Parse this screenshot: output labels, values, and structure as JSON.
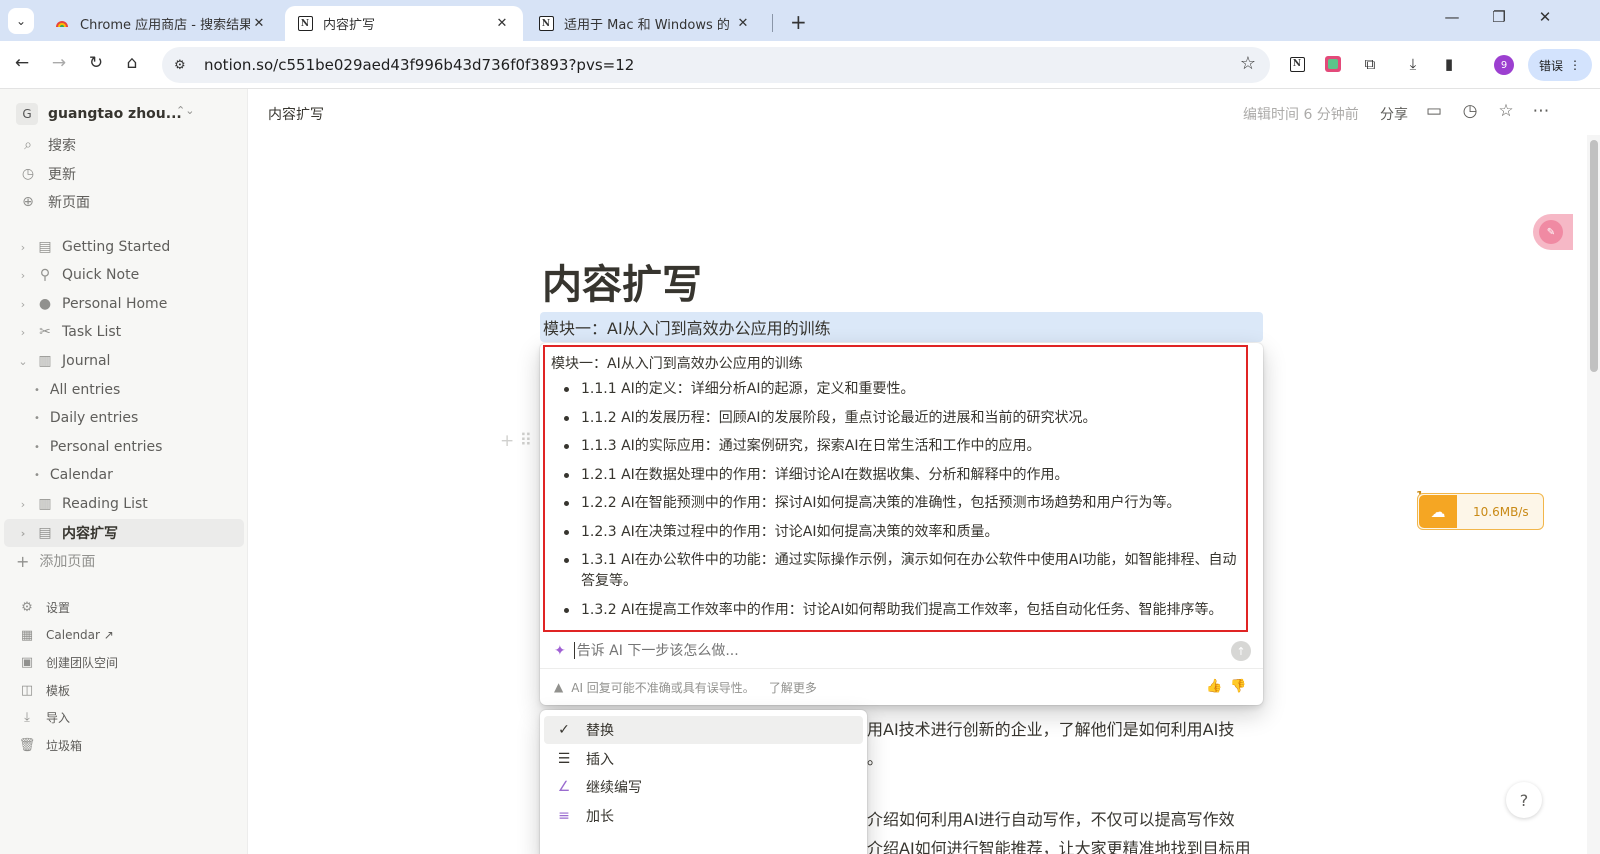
{
  "browser": {
    "tabs": [
      {
        "title": "Chrome 应用商店 - 搜索结果",
        "favicon": "chrome-webstore-icon"
      },
      {
        "title": "内容扩写",
        "favicon": "notion-icon"
      },
      {
        "title": "适用于 Mac 和 Windows 的 N",
        "favicon": "notion-icon"
      }
    ],
    "url": "notion.so/c551be029aed43f996b43d736f0f3893?pvs=12",
    "profile_initial": "9",
    "error_label": "错误"
  },
  "sidebar": {
    "workspace_initial": "G",
    "workspace_name": "guangtao zhou...",
    "quick_items": [
      {
        "label": "搜索",
        "icon": "search-icon"
      },
      {
        "label": "更新",
        "icon": "clock-icon"
      },
      {
        "label": "新页面",
        "icon": "plus-circle-icon"
      }
    ],
    "pages": [
      {
        "label": "Getting Started",
        "icon": "page-icon"
      },
      {
        "label": "Quick Note",
        "icon": "pin-icon"
      },
      {
        "label": "Personal Home",
        "icon": "person-icon"
      },
      {
        "label": "Task List",
        "icon": "tools-icon"
      },
      {
        "label": "Journal",
        "icon": "book-icon"
      }
    ],
    "journal_children": [
      "All entries",
      "Daily entries",
      "Personal entries",
      "Calendar"
    ],
    "pages_after": [
      {
        "label": "Reading List",
        "icon": "book-icon"
      },
      {
        "label": "内容扩写",
        "icon": "page-icon"
      }
    ],
    "add_page": "添加页面",
    "bottom_items": [
      {
        "label": "设置",
        "icon": "gear-icon"
      },
      {
        "label": "Calendar ↗",
        "icon": "calendar-icon"
      },
      {
        "label": "创建团队空间",
        "icon": "team-icon"
      },
      {
        "label": "模板",
        "icon": "template-icon"
      },
      {
        "label": "导入",
        "icon": "download-icon"
      },
      {
        "label": "垃圾箱",
        "icon": "trash-icon"
      }
    ]
  },
  "topbar": {
    "breadcrumb": "内容扩写",
    "edited": "编辑时间 6 分钟前",
    "share": "分享"
  },
  "page": {
    "title": "内容扩写",
    "selected_block": "模块一：AI从入门到高效办公应用的训练"
  },
  "ai": {
    "result_heading": "模块一：AI从入门到高效办公应用的训练",
    "result_items": [
      "1.1.1 AI的定义：详细分析AI的起源，定义和重要性。",
      "1.1.2 AI的发展历程：回顾AI的发展阶段，重点讨论最近的进展和当前的研究状况。",
      "1.1.3 AI的实际应用：通过案例研究，探索AI在日常生活和工作中的应用。",
      "1.2.1 AI在数据处理中的作用：详细讨论AI在数据收集、分析和解释中的作用。",
      "1.2.2 AI在智能预测中的作用：探讨AI如何提高决策的准确性，包括预测市场趋势和用户行为等。",
      "1.2.3 AI在决策过程中的作用：讨论AI如何提高决策的效率和质量。",
      "1.3.1 AI在办公软件中的功能：通过实际操作示例，演示如何在办公软件中使用AI功能，如智能排程、自动答复等。",
      "1.3.2 AI在提高工作效率中的作用：讨论AI如何帮助我们提高工作效率，包括自动化任务、智能排序等。"
    ],
    "input_placeholder": "告诉 AI 下一步该怎么做...",
    "disclaimer": "AI 回复可能不准确或具有误导性。",
    "learn_more": "了解更多",
    "menu": [
      {
        "label": "替换",
        "icon": "check-icon"
      },
      {
        "label": "插入",
        "icon": "insert-icon"
      },
      {
        "label": "继续编写",
        "icon": "pen-icon"
      },
      {
        "label": "加长",
        "icon": "lines-icon"
      }
    ]
  },
  "background_text": {
    "line1": "用AI技术进行创新的企业，了解他们是如何利用AI技",
    "line2": "。",
    "line3": "介绍如何利用AI进行自动写作，不仅可以提高写作效",
    "line4": "介绍AI如何进行智能推荐，让大家更精准地找到目标用"
  },
  "overlays": {
    "speed_badge": "1",
    "speed_value": "10.6MB/s",
    "help": "?"
  }
}
